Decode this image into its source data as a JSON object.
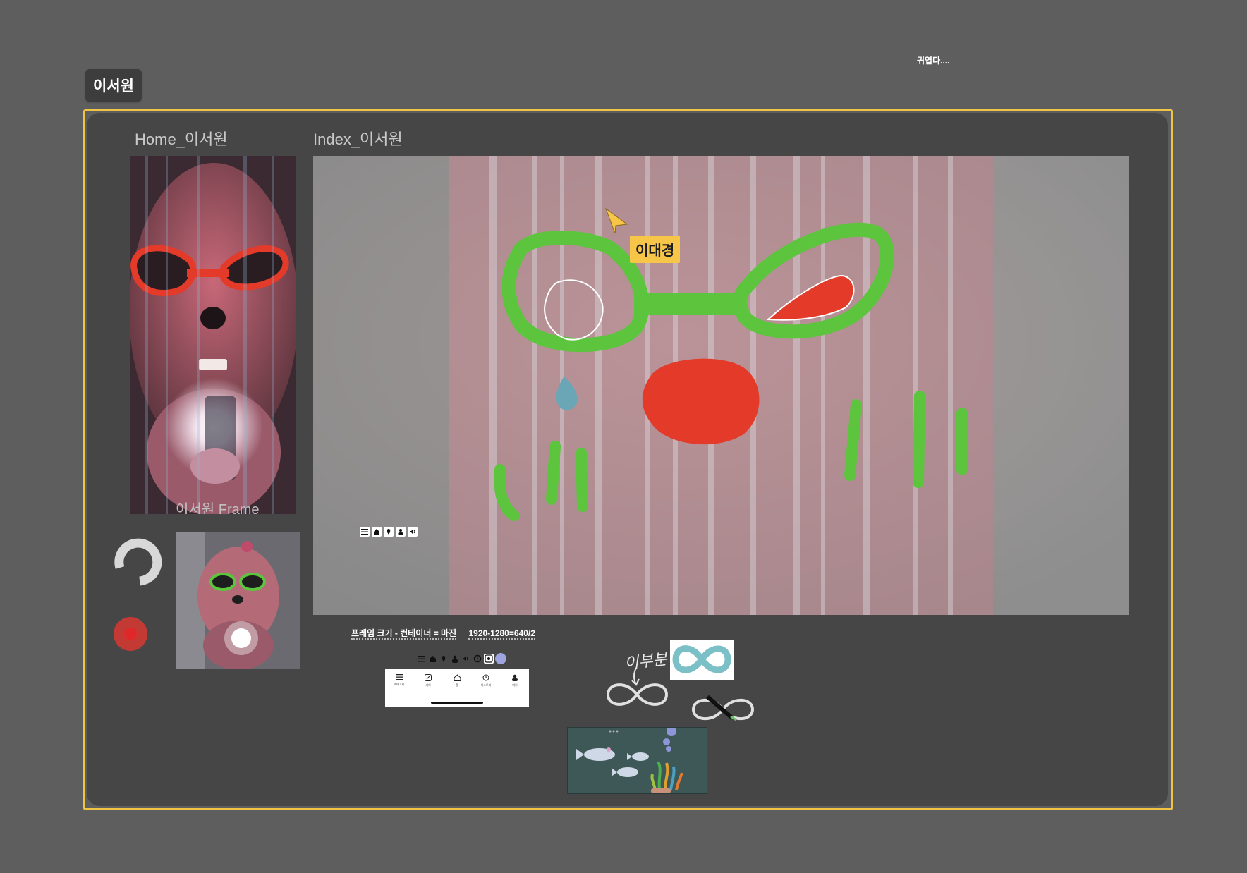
{
  "canvas": {
    "background_color": "#5e5e5e",
    "corner_note": "귀엽다....",
    "user_badge": "이서원"
  },
  "board": {
    "frame_color": "#f0c445",
    "background_color": "#464646",
    "home_frame": {
      "label": "Home_이서원",
      "caption": "이서원 Frame"
    },
    "index_frame": {
      "label": "Index_이서원"
    },
    "cursor": {
      "user_name": "이대경",
      "color": "#f7c548"
    },
    "drawing_colors": {
      "glasses": "#5cc43d",
      "nose": "#e43a2a",
      "tear": "#6aa6b5",
      "stripe": "#e8a9b4"
    }
  },
  "controls": {
    "rotate_icon": "refresh-icon",
    "record_icon": "record-icon",
    "record_color": "#c33a35"
  },
  "notes": {
    "frame_formula": "프레임 크기 - 컨테이너 = 마진",
    "frame_numbers": "1920-1280=640/2",
    "handwriting": "이부분",
    "nav_icons": [
      "menu-icon",
      "home-icon",
      "location-pin-icon",
      "person-icon",
      "speaker-icon"
    ]
  },
  "tabbar": {
    "tabs": [
      {
        "icon": "menu-icon",
        "label": "카테고리"
      },
      {
        "icon": "edit-icon",
        "label": "셰어"
      },
      {
        "icon": "home-icon",
        "label": "홈"
      },
      {
        "icon": "history-icon",
        "label": "히스토리"
      },
      {
        "icon": "person-icon",
        "label": "마이"
      }
    ]
  }
}
